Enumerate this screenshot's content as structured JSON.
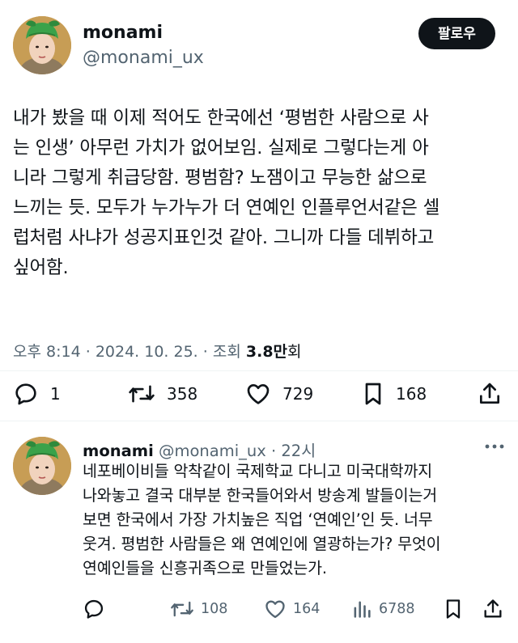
{
  "tweet": {
    "author_name": "monami",
    "author_handle": "@monami_ux",
    "follow_label": "팔로우",
    "text": "내가 봤을 때 이제 적어도 한국에선 ‘평범한 사람으로 사\n는 인생’ 아무런 가치가 없어보임. 실제로 그렇다는게 아\n니라 그렇게 취급당함. 평범함? 노잼이고 무능한 삶으로\n느끼는 듯. 모두가 누가누가 더 연예인 인플루언서같은 셀\n럽처럼 사냐가 성공지표인것 같아. 그니까 다들 데뷔하고\n싶어함.",
    "time": "오후 8:14",
    "date": "2024. 10. 25.",
    "views_label": "조회",
    "views_number": "3.8",
    "views_unit": "만회",
    "separator": "·",
    "replies": "1",
    "reposts": "358",
    "likes": "729",
    "bookmarks": "168"
  },
  "reply": {
    "author_name": "monami",
    "author_handle": "@monami_ux",
    "separator": "·",
    "time": "22시",
    "text": "네포베이비들 악착같이 국제학교 다니고 미국대학까지\n나와놓고 결국 대부분 한국들어와서 방송계 발들이는거\n보면 한국에서 가장 가치높은 직업 ‘연예인’인 듯. 너무\n웃겨. 평범한 사람들은 왜 연예인에 열광하는가? 무엇이\n연예인들을 신흥귀족으로 만들었는가.",
    "reposts": "108",
    "likes": "164",
    "views": "6788"
  },
  "icons": {
    "reply": "speech-bubble-icon",
    "repost": "repost-arrows-icon",
    "like": "heart-icon",
    "bookmark": "bookmark-icon",
    "share": "share-icon",
    "views": "bar-chart-icon",
    "more": "more-dots-icon"
  },
  "colors": {
    "text": "#0f1419",
    "secondary": "#536471",
    "divider": "#eff3f4",
    "follow_bg": "#0f1419"
  }
}
